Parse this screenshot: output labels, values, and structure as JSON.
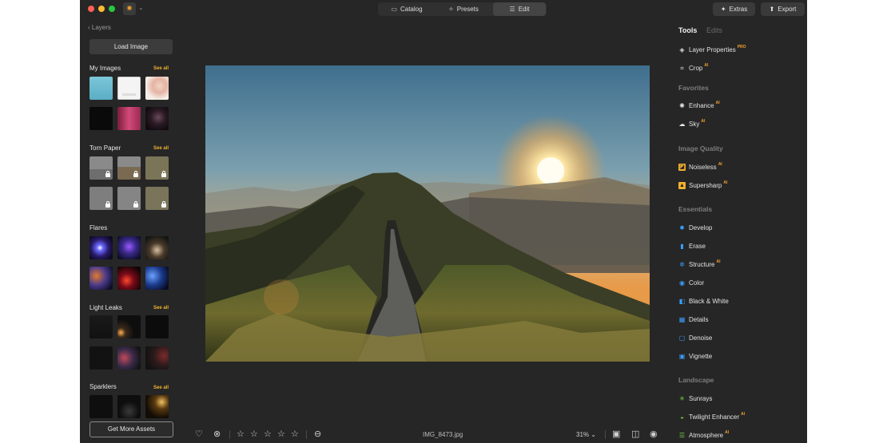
{
  "titlebar": {
    "traffic_colors": [
      "#fe5f57",
      "#febc2e",
      "#28c840"
    ],
    "logo_icon": "sun-logo-icon",
    "modes": [
      {
        "label": "Catalog",
        "icon": "folder-icon",
        "active": false
      },
      {
        "label": "Presets",
        "icon": "sparkle-icon",
        "active": false
      },
      {
        "label": "Edit",
        "icon": "sliders-icon",
        "active": true
      }
    ],
    "extras_label": "Extras",
    "export_label": "Export"
  },
  "left_panel": {
    "back_label": "Layers",
    "load_image_label": "Load Image",
    "see_all_label": "See all",
    "sections": [
      {
        "title": "My Images",
        "see_all": true
      },
      {
        "title": "Torn Paper",
        "see_all": true
      },
      {
        "title": "Flares",
        "see_all": false
      },
      {
        "title": "Light Leaks",
        "see_all": true
      },
      {
        "title": "Sparklers",
        "see_all": true
      }
    ],
    "get_more_assets_label": "Get More Assets"
  },
  "bottom_bar": {
    "file_name": "IMG_8473.jpg",
    "zoom": "31%",
    "rating_stars": 5
  },
  "right_panel": {
    "tabs": [
      {
        "label": "Tools",
        "active": true
      },
      {
        "label": "Edits",
        "active": false
      }
    ],
    "top_tools": [
      {
        "label": "Layer Properties",
        "badge": "PRO",
        "icon": "layers-icon"
      },
      {
        "label": "Crop",
        "badge": "AI",
        "icon": "crop-icon"
      }
    ],
    "groups": [
      {
        "title": "Favorites",
        "tools": [
          {
            "label": "Enhance",
            "badge": "AI",
            "icon": "enhance-icon"
          },
          {
            "label": "Sky",
            "badge": "AI",
            "icon": "cloud-icon"
          }
        ]
      },
      {
        "title": "Image Quality",
        "tools": [
          {
            "label": "Noiseless",
            "badge": "AI",
            "icon": "noiseless-icon"
          },
          {
            "label": "Supersharp",
            "badge": "AI",
            "icon": "supersharp-icon"
          }
        ]
      },
      {
        "title": "Essentials",
        "tools": [
          {
            "label": "Develop",
            "badge": "",
            "icon": "develop-icon"
          },
          {
            "label": "Erase",
            "badge": "",
            "icon": "eraser-icon"
          },
          {
            "label": "Structure",
            "badge": "AI",
            "icon": "structure-icon"
          },
          {
            "label": "Color",
            "badge": "",
            "icon": "color-icon"
          },
          {
            "label": "Black & White",
            "badge": "",
            "icon": "black-white-icon"
          },
          {
            "label": "Details",
            "badge": "",
            "icon": "details-icon"
          },
          {
            "label": "Denoise",
            "badge": "",
            "icon": "denoise-icon"
          },
          {
            "label": "Vignette",
            "badge": "",
            "icon": "vignette-icon"
          }
        ]
      },
      {
        "title": "Landscape",
        "tools": [
          {
            "label": "Sunrays",
            "badge": "",
            "icon": "sunrays-icon"
          },
          {
            "label": "Twilight Enhancer",
            "badge": "AI",
            "icon": "twilight-icon"
          },
          {
            "label": "Atmosphere",
            "badge": "AI",
            "icon": "atmosphere-icon"
          }
        ]
      }
    ]
  },
  "colors": {
    "background": "#262626",
    "accent": "#f0a030",
    "tool_icon_blue": "#3aa0ff",
    "tool_icon_green": "#7cd44a"
  }
}
